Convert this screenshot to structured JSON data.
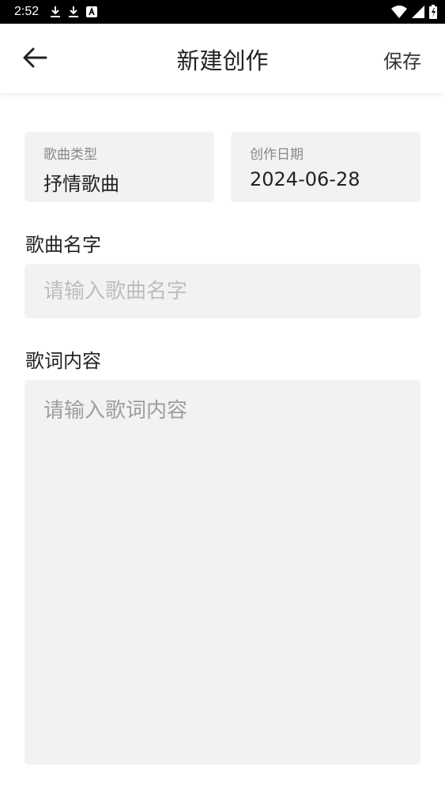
{
  "status_bar": {
    "time": "2:52",
    "left_icons": [
      "download-icon",
      "download-icon",
      "a-badge-icon"
    ],
    "right_icons": [
      "wifi-icon",
      "signal-icon",
      "battery-icon"
    ]
  },
  "app_bar": {
    "title": "新建创作",
    "save_label": "保存"
  },
  "song_type": {
    "caption": "歌曲类型",
    "value": "抒情歌曲"
  },
  "creation_date": {
    "caption": "创作日期",
    "value": "2024-06-28"
  },
  "song_name": {
    "label": "歌曲名字",
    "placeholder": "请输入歌曲名字",
    "value": ""
  },
  "lyrics": {
    "label": "歌词内容",
    "placeholder": "请输入歌词内容",
    "value": ""
  },
  "colors": {
    "field_background": "#f2f2f2",
    "status_bar": "#000000",
    "placeholder": "#bdbdbd"
  }
}
